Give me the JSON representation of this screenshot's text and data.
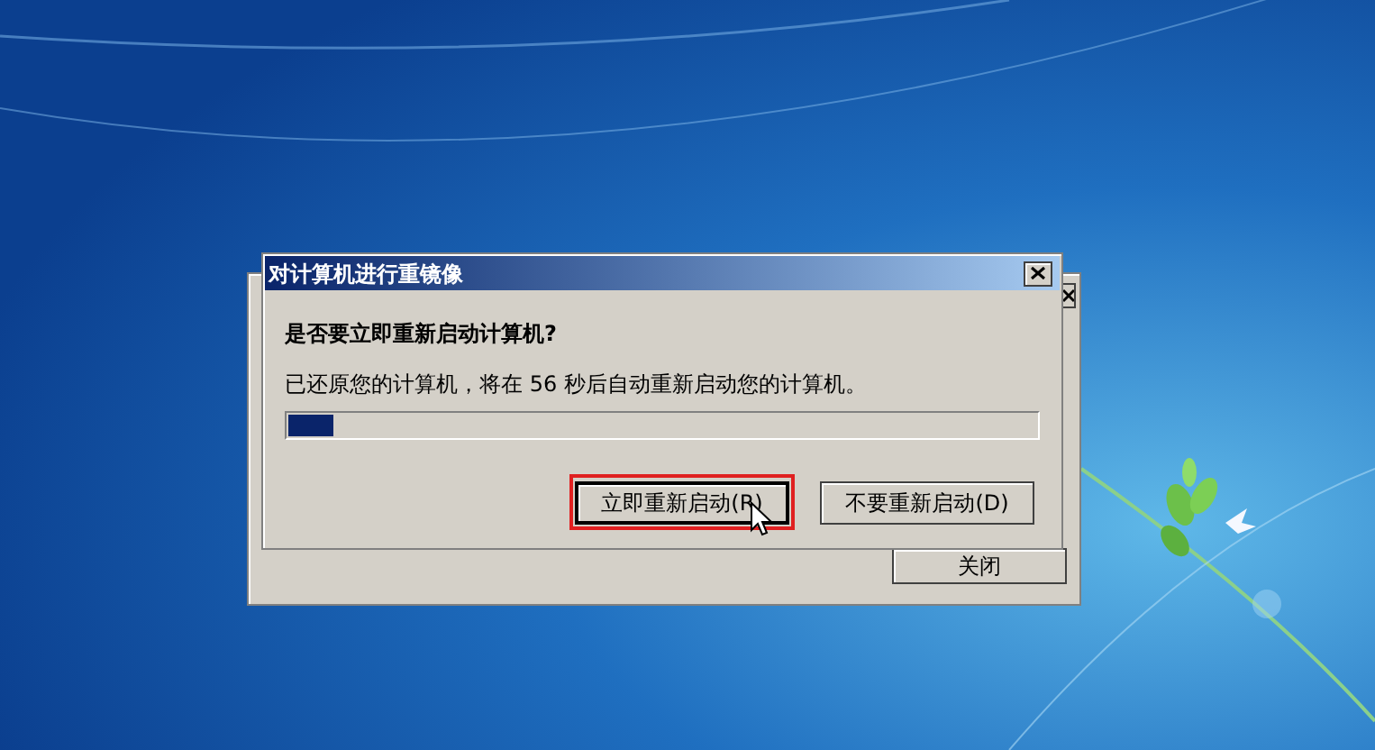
{
  "back_window": {
    "close_button": "关闭"
  },
  "dialog": {
    "title": "对计算机进行重镜像",
    "heading": "是否要立即重新启动计算机?",
    "message": "已还原您的计算机，将在 56 秒后自动重新启动您的计算机。",
    "progress": {
      "level": 0.06
    },
    "buttons": [
      {
        "label": "立即重新启动(R)",
        "highlighted": true
      },
      {
        "label": "不要重新启动(D)",
        "highlighted": false
      }
    ]
  }
}
